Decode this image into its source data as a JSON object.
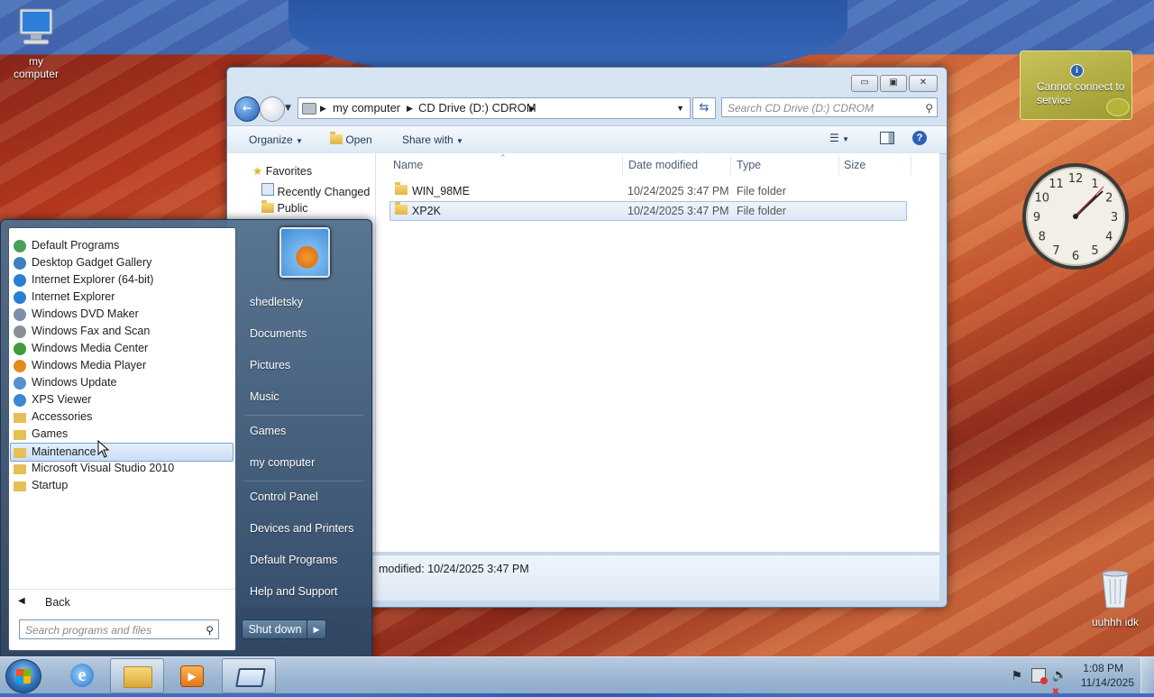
{
  "desktop": {
    "icons": [
      {
        "label": "my\ncomputer"
      },
      {
        "label": "uuhhh idk"
      }
    ],
    "weather_gadget": {
      "message": "Cannot connect to service"
    },
    "clock_gadget": {
      "numbers": [
        "12",
        "1",
        "2",
        "3",
        "4",
        "5",
        "6",
        "7",
        "8",
        "9",
        "10",
        "11"
      ]
    }
  },
  "explorer": {
    "caption_buttons": {
      "minimize": "▭",
      "maximize": "▣",
      "close": "✕"
    },
    "address": {
      "crumbs": [
        "my computer",
        "CD Drive (D:) CDROM"
      ]
    },
    "search": {
      "placeholder": "Search CD Drive (D:) CDROM"
    },
    "toolbar": {
      "organize": "Organize",
      "open": "Open",
      "share_with": "Share with"
    },
    "nav_pane": {
      "favorites": "Favorites",
      "items": [
        "Recently Changed",
        "Public"
      ]
    },
    "columns": {
      "name": "Name",
      "date_modified": "Date modified",
      "type": "Type",
      "size": "Size"
    },
    "files": [
      {
        "name": "WIN_98ME",
        "date": "10/24/2025 3:47 PM",
        "type": "File folder",
        "selected": false
      },
      {
        "name": "XP2K",
        "date": "10/24/2025 3:47 PM",
        "type": "File folder",
        "selected": true
      }
    ],
    "details": {
      "modified_text": "modified:  10/24/2025 3:47 PM"
    }
  },
  "start_menu": {
    "programs": [
      {
        "label": "Default Programs",
        "icon": "default-programs-icon",
        "color": "#4aa05a"
      },
      {
        "label": "Desktop Gadget Gallery",
        "icon": "gadget-gallery-icon",
        "color": "#3d7fc1"
      },
      {
        "label": "Internet Explorer (64-bit)",
        "icon": "internet-explorer-icon",
        "color": "#2b7fd3"
      },
      {
        "label": "Internet Explorer",
        "icon": "internet-explorer-icon",
        "color": "#2b7fd3"
      },
      {
        "label": "Windows DVD Maker",
        "icon": "dvd-maker-icon",
        "color": "#7b8fa8"
      },
      {
        "label": "Windows Fax and Scan",
        "icon": "fax-scan-icon",
        "color": "#8a8f96"
      },
      {
        "label": "Windows Media Center",
        "icon": "media-center-icon",
        "color": "#3f9c3a"
      },
      {
        "label": "Windows Media Player",
        "icon": "media-player-icon",
        "color": "#e58a1e"
      },
      {
        "label": "Windows Update",
        "icon": "windows-update-icon",
        "color": "#5a8fcf"
      },
      {
        "label": "XPS Viewer",
        "icon": "xps-viewer-icon",
        "color": "#3b88d0"
      },
      {
        "label": "Accessories",
        "icon": "folder-icon",
        "color": "#e6bf55"
      },
      {
        "label": "Games",
        "icon": "folder-icon",
        "color": "#e6bf55"
      },
      {
        "label": "Maintenance",
        "icon": "folder-icon",
        "color": "#e6bf55",
        "highlighted": true
      },
      {
        "label": "Microsoft Visual Studio 2010",
        "icon": "folder-icon",
        "color": "#e6bf55"
      },
      {
        "label": "Startup",
        "icon": "folder-icon",
        "color": "#e6bf55"
      }
    ],
    "back": "Back",
    "search_placeholder": "Search programs and files",
    "right_links": [
      "shedletsky",
      "Documents",
      "Pictures",
      "Music",
      "Games",
      "my computer",
      "Control Panel",
      "Devices and Printers",
      "Default Programs",
      "Help and Support"
    ],
    "shutdown": "Shut down"
  },
  "taskbar": {
    "time": "1:08 PM",
    "date": "11/14/2025"
  }
}
